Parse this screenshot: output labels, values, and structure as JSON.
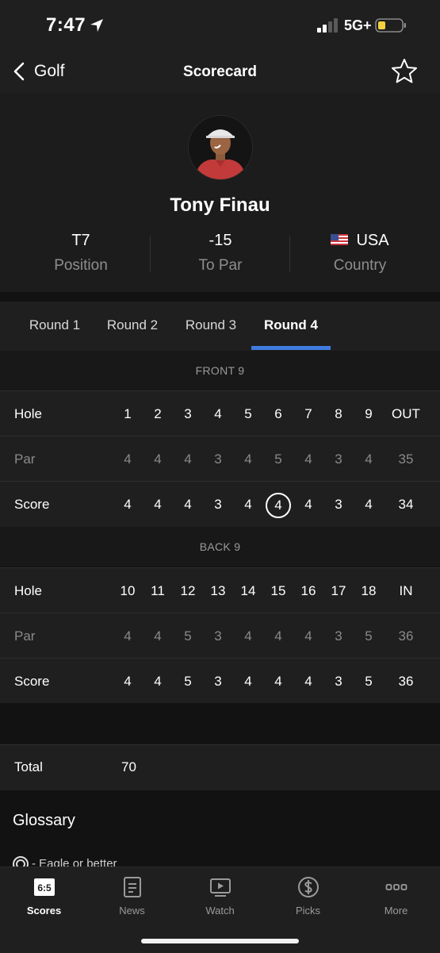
{
  "status": {
    "time": "7:47",
    "network": "5G+"
  },
  "nav": {
    "back_label": "Golf",
    "title": "Scorecard"
  },
  "player": {
    "name": "Tony Finau",
    "stats": [
      {
        "value": "T7",
        "label": "Position"
      },
      {
        "value": "-15",
        "label": "To Par"
      },
      {
        "value": "USA",
        "label": "Country"
      }
    ]
  },
  "rounds": [
    "Round 1",
    "Round 2",
    "Round 3",
    "Round 4"
  ],
  "active_round": "Round 4",
  "front9": {
    "header": "FRONT 9",
    "hole_label": "Hole",
    "par_label": "Par",
    "score_label": "Score",
    "holes": [
      "1",
      "2",
      "3",
      "4",
      "5",
      "6",
      "7",
      "8",
      "9",
      "OUT"
    ],
    "par": [
      "4",
      "4",
      "4",
      "3",
      "4",
      "5",
      "4",
      "3",
      "4",
      "35"
    ],
    "score": [
      "4",
      "4",
      "4",
      "3",
      "4",
      "4",
      "4",
      "3",
      "4",
      "34"
    ]
  },
  "back9": {
    "header": "BACK 9",
    "hole_label": "Hole",
    "par_label": "Par",
    "score_label": "Score",
    "holes": [
      "10",
      "11",
      "12",
      "13",
      "14",
      "15",
      "16",
      "17",
      "18",
      "IN"
    ],
    "par": [
      "4",
      "4",
      "5",
      "3",
      "4",
      "4",
      "4",
      "3",
      "5",
      "36"
    ],
    "score": [
      "4",
      "4",
      "5",
      "3",
      "4",
      "4",
      "4",
      "3",
      "5",
      "36"
    ]
  },
  "total": {
    "label": "Total",
    "value": "70"
  },
  "glossary": {
    "title": "Glossary",
    "first_item": "- Eagle or better"
  },
  "tabbar": [
    {
      "label": "Scores",
      "icon": "scores-icon",
      "icon_text": "6:5"
    },
    {
      "label": "News",
      "icon": "news-icon"
    },
    {
      "label": "Watch",
      "icon": "watch-icon"
    },
    {
      "label": "Picks",
      "icon": "picks-icon"
    },
    {
      "label": "More",
      "icon": "more-icon"
    }
  ],
  "colors": {
    "accent": "#3f7be0",
    "background": "#121212",
    "surface": "#1f1f1f"
  }
}
